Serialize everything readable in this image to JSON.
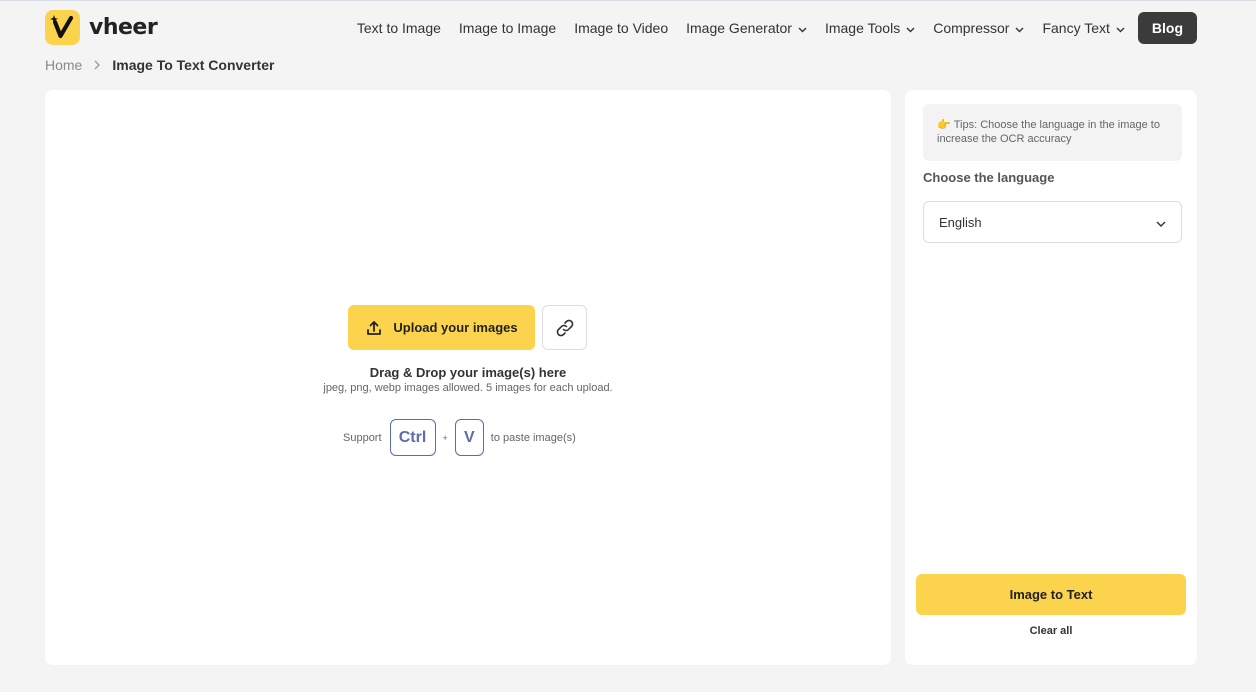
{
  "brand": {
    "name": "vheer",
    "color": "#fcd34d"
  },
  "nav": {
    "items": [
      {
        "label": "Text to Image",
        "dropdown": false
      },
      {
        "label": "Image to Image",
        "dropdown": false
      },
      {
        "label": "Image to Video",
        "dropdown": false
      },
      {
        "label": "Image Generator",
        "dropdown": true
      },
      {
        "label": "Image Tools",
        "dropdown": true
      },
      {
        "label": "Compressor",
        "dropdown": true
      },
      {
        "label": "Fancy Text",
        "dropdown": true
      }
    ],
    "blog_label": "Blog"
  },
  "breadcrumb": {
    "home": "Home",
    "current": "Image To Text Converter"
  },
  "upload": {
    "button_label": "Upload your images",
    "upload_icon": "upload-icon",
    "link_icon": "link-icon",
    "drag_title": "Drag & Drop your image(s) here",
    "drag_subtitle": "jpeg, png, webp images allowed. 5 images for each upload.",
    "paste_prefix": "Support",
    "key_ctrl": "Ctrl",
    "plus": "+",
    "key_v": "V",
    "paste_suffix": "to paste image(s)"
  },
  "sidebar": {
    "tips_icon": "pointing-hand-icon",
    "tips_text": "Tips: Choose the language in the image to increase the OCR accuracy",
    "language_label": "Choose the language",
    "language_value": "English",
    "convert_label": "Image to Text",
    "clear_label": "Clear all"
  },
  "colors": {
    "accent": "#fcd34d",
    "key_border": "#5b6bb0",
    "blog_bg": "#3b3b3b"
  }
}
